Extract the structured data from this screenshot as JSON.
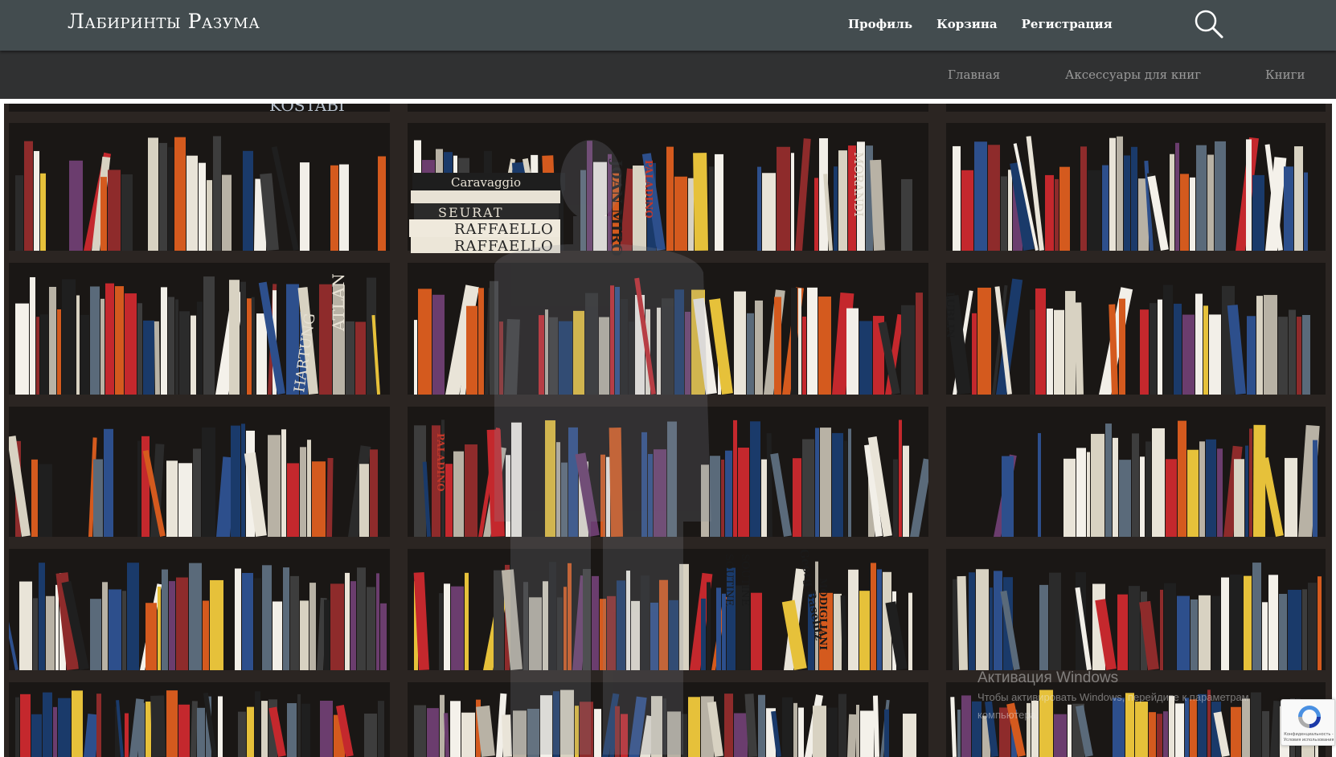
{
  "header": {
    "site_title": "Лабиринты Разума",
    "user_nav": [
      {
        "label": "Профиль"
      },
      {
        "label": "Корзина"
      },
      {
        "label": "Регистрация"
      }
    ],
    "search_icon": "search-icon"
  },
  "main_nav": [
    {
      "label": "Главная"
    },
    {
      "label": "Аксессуары для книг"
    },
    {
      "label": "Книги"
    }
  ],
  "hero": {
    "image": "bookshelf-photo",
    "spine_text": {
      "kostabi": "KOSTABI",
      "caravaggio": "Caravaggio",
      "seurat": "SEURAT",
      "raffaello_1": "RAFFAELLO",
      "raffaello_2": "RAFFAELLO",
      "joan_miro": "JOAN MIRO",
      "paladino": "PALADINO",
      "morandi": "MORANDI",
      "atlan": "ATLAN",
      "hartung": "HARTUNG",
      "lublin": "LUBLIN",
      "paladino_2": "PALADINO",
      "soutine_1": "SOUTINE",
      "soutine_2": "SOUTINE",
      "georg_baselitz": "Georg Baselitz",
      "modigliani": "MODIGLIANI"
    }
  },
  "os_watermark": {
    "title": "Активация Windows",
    "line1": "Чтобы активировать Windows, перейдите к параметрам",
    "line2": "компьютера."
  },
  "recaptcha": {
    "line1": "Конфиденциальность -",
    "line2": "Условия использования"
  },
  "colors": {
    "topbar": "#434c4f",
    "mainbar": "#303132",
    "nav_text": "#9a9a9a"
  }
}
